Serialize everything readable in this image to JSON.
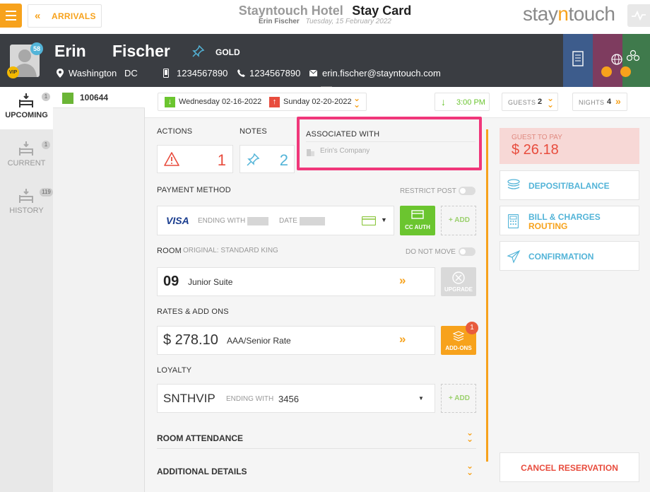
{
  "topbar": {
    "arrivals_label": "ARRIVALS",
    "hotel_name": "Stayntouch Hotel",
    "page_title": "Stay Card",
    "guest_name": "Erin Fischer",
    "date": "Tuesday, 15 February 2022",
    "brand_a": "stay",
    "brand_b": "n",
    "brand_c": "touch"
  },
  "guest": {
    "first_name": "Erin",
    "last_name": "Fischer",
    "badge_count": "58",
    "vip": "VIP",
    "tier": "GOLD",
    "city": "Washington",
    "state": "DC",
    "mobile": "1234567890",
    "phone": "1234567890",
    "email": "erin.fischer@stayntouch.com"
  },
  "sidebar": {
    "items": [
      {
        "label": "UPCOMING",
        "count": "1"
      },
      {
        "label": "CURRENT",
        "count": "1"
      },
      {
        "label": "HISTORY",
        "count": "119"
      }
    ]
  },
  "reservation_list": {
    "number": "100644",
    "status_color": "#6bb536"
  },
  "dates": {
    "arrival": "Wednesday 02-16-2022",
    "departure": "Sunday 02-20-2022",
    "time": "3:00 PM",
    "guests_label": "GUESTS",
    "guests": "2",
    "nights_label": "NIGHTS",
    "nights": "4"
  },
  "sections": {
    "actions_label": "ACTIONS",
    "actions_count": "1",
    "notes_label": "NOTES",
    "notes_count": "2",
    "associated_label": "ASSOCIATED WITH",
    "company": "Erin's Company"
  },
  "payment": {
    "label": "PAYMENT METHOD",
    "restrict_post": "RESTRICT POST",
    "card_brand": "VISA",
    "ending_with": "ENDING WITH",
    "date_label": "DATE",
    "cc_auth": "CC AUTH",
    "add": "+ ADD"
  },
  "room": {
    "label": "ROOM",
    "original": "ORIGINAL: STANDARD KING",
    "do_not_move": "DO NOT MOVE",
    "number": "09",
    "type": "Junior Suite",
    "upgrade": "UPGRADE"
  },
  "rates": {
    "label": "RATES & ADD ONS",
    "amount": "$ 278.10",
    "rate_name": "AAA/Senior Rate",
    "addons": "ADD-ONS",
    "addons_count": "1"
  },
  "loyalty": {
    "label": "LOYALTY",
    "program": "SNTHVIP",
    "ending_with": "ENDING WITH",
    "number": "3456",
    "add": "+ ADD"
  },
  "collapsibles": {
    "room_attendance": "ROOM ATTENDANCE",
    "additional_details": "ADDITIONAL DETAILS"
  },
  "right_panel": {
    "guest_to_pay_label": "GUEST TO PAY",
    "guest_to_pay": "$ 26.18",
    "deposit": "DEPOSIT/BALANCE",
    "bill_line1": "BILL & CHARGES",
    "bill_line2": "ROUTING",
    "confirmation": "CONFIRMATION",
    "cancel": "CANCEL RESERVATION"
  },
  "colors": {
    "accent": "#f7a21c",
    "header_dark": "#3a3d42",
    "highlight": "#f0377a",
    "green": "#6bc52f",
    "red": "#e84c3d"
  }
}
